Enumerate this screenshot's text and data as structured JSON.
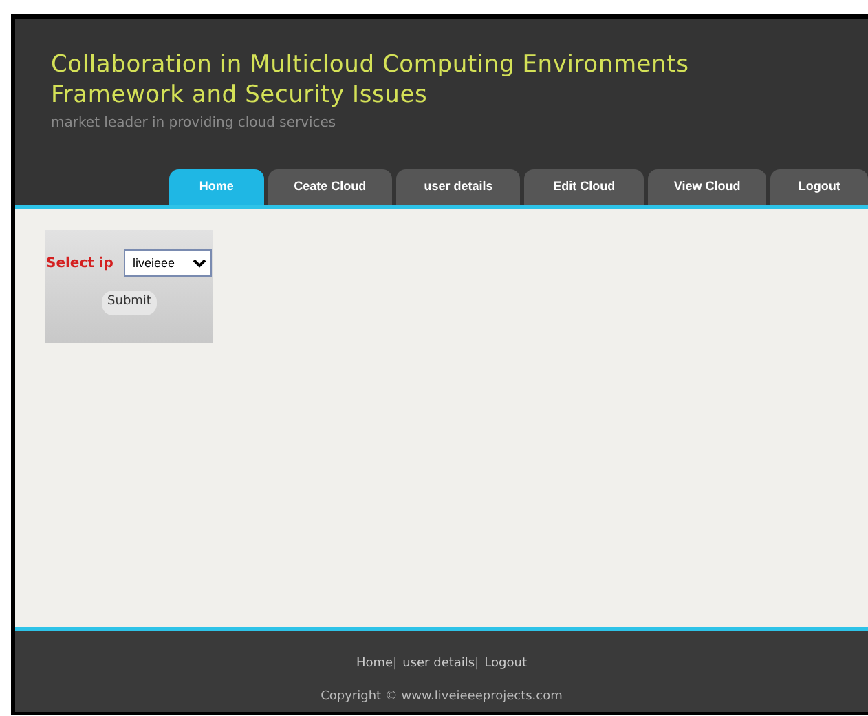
{
  "header": {
    "title_lines": [
      "Collaboration in Multicloud Computing Environments",
      "Framework and Security Issues"
    ],
    "tagline": "market leader in providing cloud services"
  },
  "tabs": [
    {
      "label": "Home",
      "selected": true
    },
    {
      "label": "Ceate Cloud",
      "selected": false
    },
    {
      "label": "user details",
      "selected": false
    },
    {
      "label": "Edit Cloud",
      "selected": false
    },
    {
      "label": "View Cloud",
      "selected": false
    },
    {
      "label": "Logout",
      "selected": false
    }
  ],
  "form": {
    "label": "Select ip",
    "select_value": "liveieee",
    "button": "Submit"
  },
  "footer": {
    "links": [
      "Home",
      "user details",
      "Logout"
    ],
    "separator": "|",
    "copyright": "Copyright © www.liveieeeprojects.com"
  }
}
